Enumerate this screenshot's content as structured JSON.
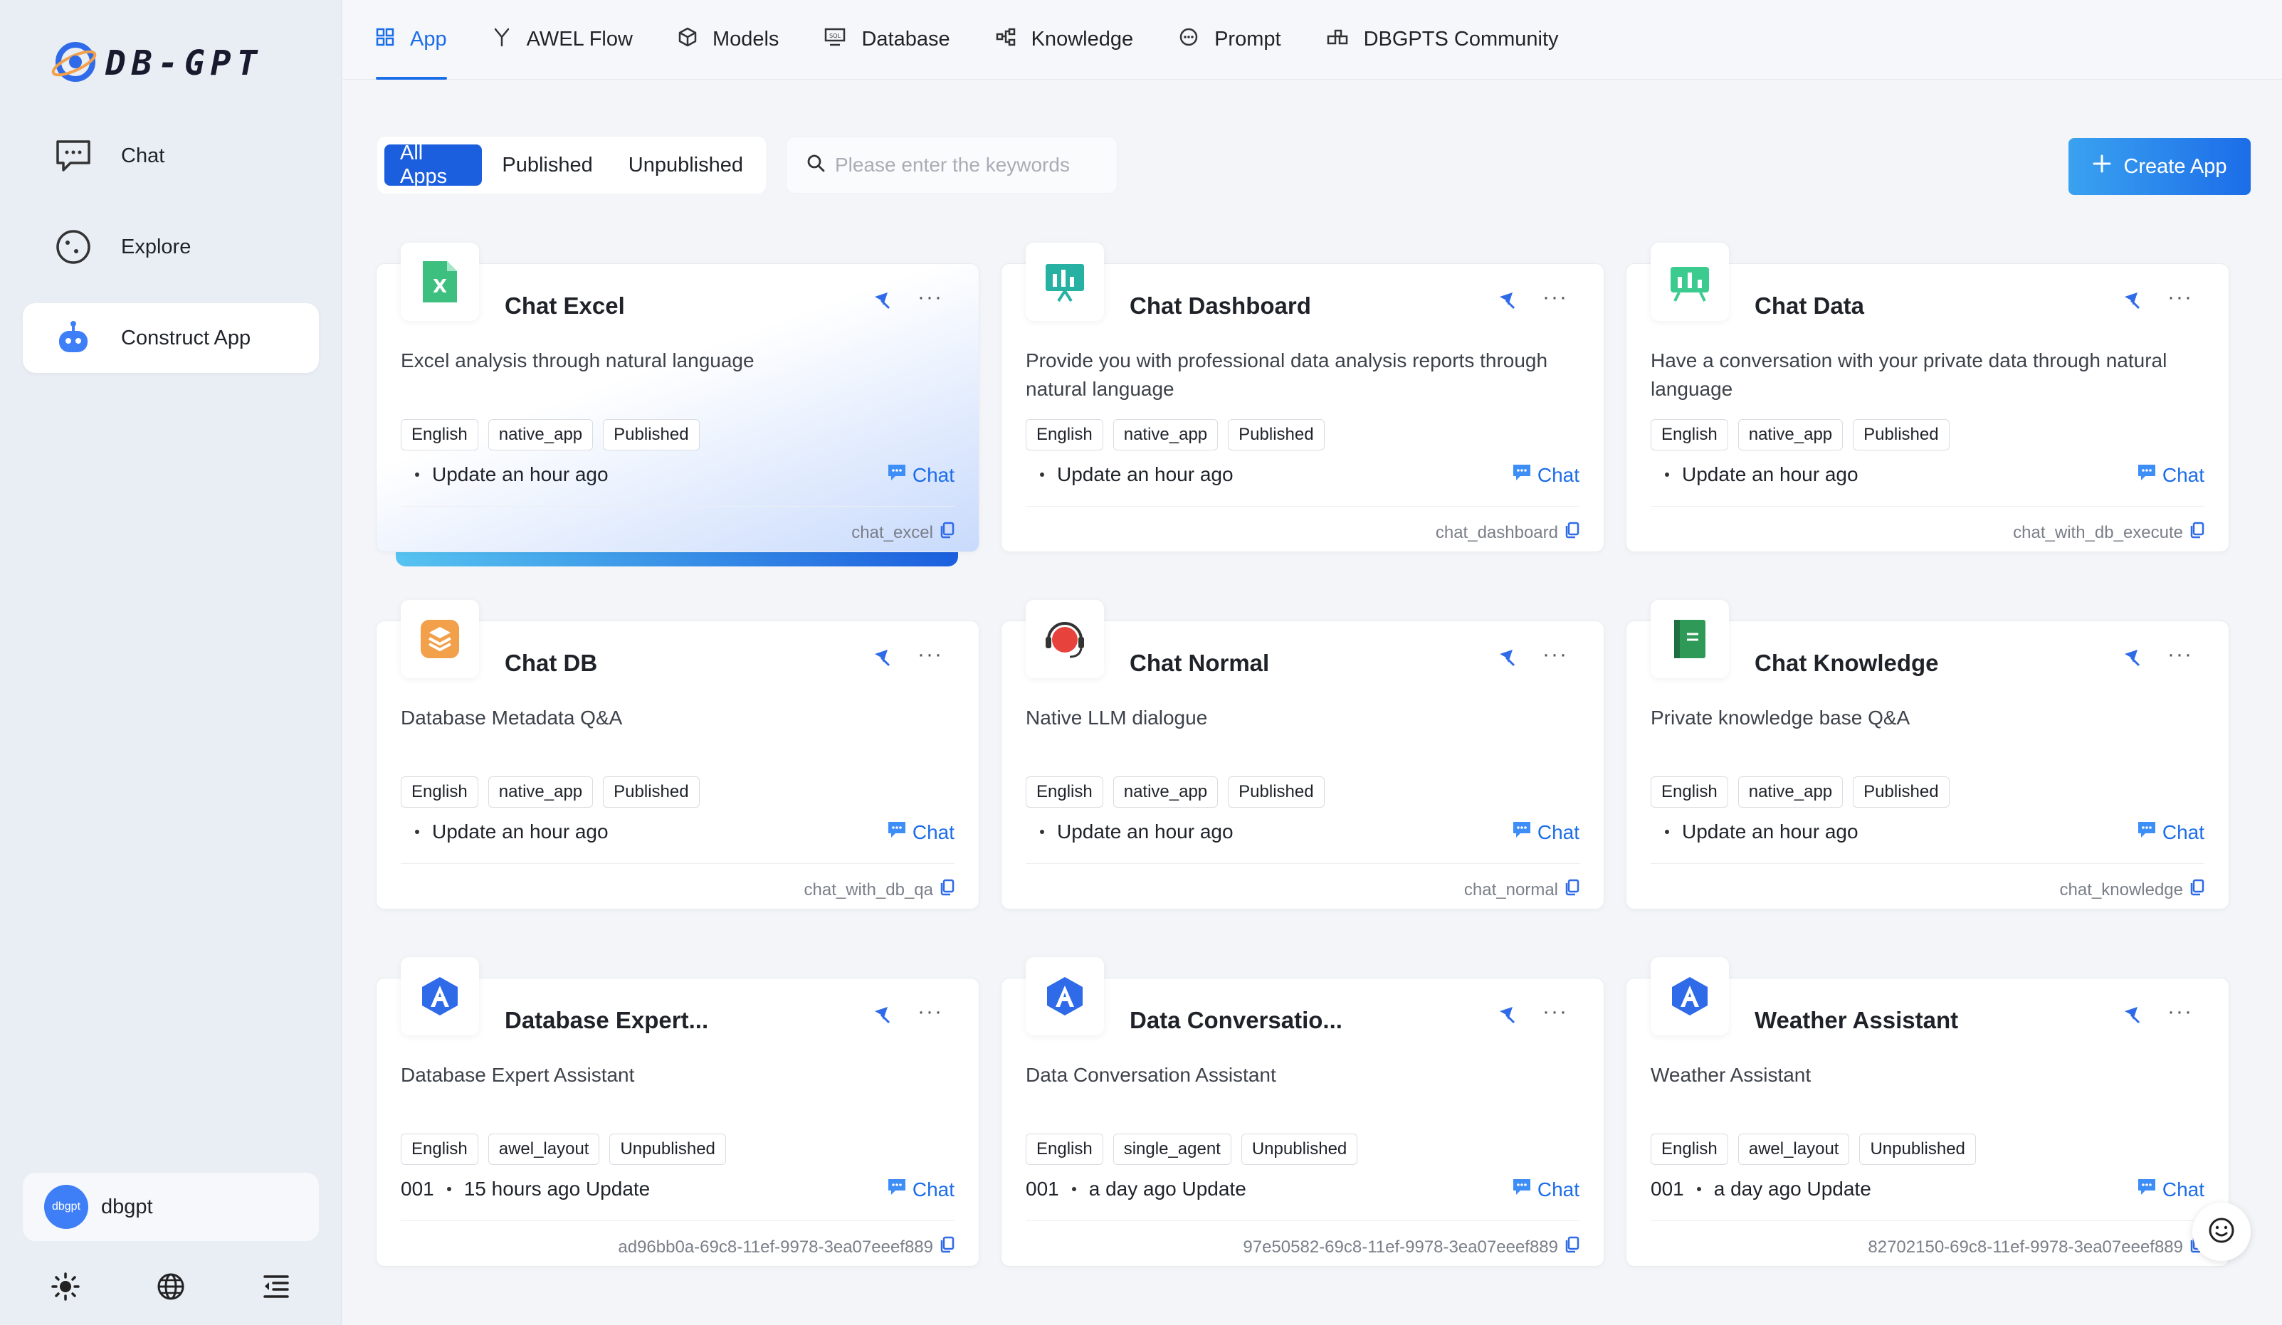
{
  "brand": {
    "logo_text": "DB-GPT"
  },
  "sidebar": {
    "items": [
      {
        "label": "Chat",
        "icon": "chat-icon"
      },
      {
        "label": "Explore",
        "icon": "explore-icon"
      },
      {
        "label": "Construct App",
        "icon": "robot-icon"
      }
    ],
    "user": {
      "avatar_text": "dbgpt",
      "name": "dbgpt"
    },
    "bottom_icons": [
      "sun-icon",
      "globe-icon",
      "menu-collapse-icon"
    ]
  },
  "topnav": {
    "tabs": [
      {
        "label": "App",
        "icon": "app-grid-icon"
      },
      {
        "label": "AWEL Flow",
        "icon": "flow-icon"
      },
      {
        "label": "Models",
        "icon": "cube-icon"
      },
      {
        "label": "Database",
        "icon": "database-icon"
      },
      {
        "label": "Knowledge",
        "icon": "knowledge-icon"
      },
      {
        "label": "Prompt",
        "icon": "prompt-icon"
      },
      {
        "label": "DBGPTS Community",
        "icon": "community-icon"
      }
    ]
  },
  "filters": {
    "all": "All Apps",
    "published": "Published",
    "unpublished": "Unpublished"
  },
  "search": {
    "placeholder": "Please enter the keywords"
  },
  "create_button": "Create App",
  "chat_label": "Chat",
  "cards": [
    {
      "title": "Chat Excel",
      "desc": "Excel analysis through natural language",
      "tags": [
        "English",
        "native_app",
        "Published"
      ],
      "prefix": "",
      "update": "Update an hour ago",
      "code": "chat_excel",
      "icon": "excel-icon",
      "icon_color": "#3dbf80"
    },
    {
      "title": "Chat Dashboard",
      "desc": "Provide you with professional data analysis reports through natural language",
      "tags": [
        "English",
        "native_app",
        "Published"
      ],
      "prefix": "",
      "update": "Update an hour ago",
      "code": "chat_dashboard",
      "icon": "dashboard-icon",
      "icon_color": "#27b1a2"
    },
    {
      "title": "Chat Data",
      "desc": "Have a conversation with your private data through natural language",
      "tags": [
        "English",
        "native_app",
        "Published"
      ],
      "prefix": "",
      "update": "Update an hour ago",
      "code": "chat_with_db_execute",
      "icon": "chart-board-icon",
      "icon_color": "#3ccb8e"
    },
    {
      "title": "Chat DB",
      "desc": "Database Metadata Q&A",
      "tags": [
        "English",
        "native_app",
        "Published"
      ],
      "prefix": "",
      "update": "Update an hour ago",
      "code": "chat_with_db_qa",
      "icon": "database-stack-icon",
      "icon_color": "#f2a04a"
    },
    {
      "title": "Chat Normal",
      "desc": "Native LLM dialogue",
      "tags": [
        "English",
        "native_app",
        "Published"
      ],
      "prefix": "",
      "update": "Update an hour ago",
      "code": "chat_normal",
      "icon": "headset-icon",
      "icon_color": "#e8423d"
    },
    {
      "title": "Chat Knowledge",
      "desc": "Private knowledge base Q&A",
      "tags": [
        "English",
        "native_app",
        "Published"
      ],
      "prefix": "",
      "update": "Update an hour ago",
      "code": "chat_knowledge",
      "icon": "book-icon",
      "icon_color": "#2f9a58"
    },
    {
      "title": "Database Expert...",
      "desc": "Database Expert Assistant",
      "tags": [
        "English",
        "awel_layout",
        "Unpublished"
      ],
      "prefix": "001",
      "update": "15 hours ago Update",
      "code": "ad96bb0a-69c8-11ef-9978-3ea07eeef889",
      "icon": "agent-logo-icon",
      "icon_color": "#2f6ae8"
    },
    {
      "title": "Data Conversatio...",
      "desc": "Data Conversation Assistant",
      "tags": [
        "English",
        "single_agent",
        "Unpublished"
      ],
      "prefix": "001",
      "update": "a day ago Update",
      "code": "97e50582-69c8-11ef-9978-3ea07eeef889",
      "icon": "agent-logo-icon",
      "icon_color": "#2f6ae8"
    },
    {
      "title": "Weather Assistant",
      "desc": "Weather Assistant",
      "tags": [
        "English",
        "awel_layout",
        "Unpublished"
      ],
      "prefix": "001",
      "update": "a day ago Update",
      "code": "82702150-69c8-11ef-9978-3ea07eeef889",
      "icon": "agent-logo-icon",
      "icon_color": "#2f6ae8"
    }
  ]
}
